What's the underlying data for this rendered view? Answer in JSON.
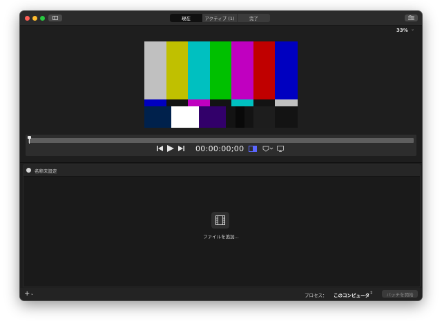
{
  "titlebar": {
    "tabs": [
      {
        "label": "現在",
        "active": true
      },
      {
        "label": "アクティブ (1)",
        "active": false
      },
      {
        "label": "完了",
        "active": false
      }
    ]
  },
  "viewer": {
    "zoom": "33%",
    "timecode": "00:00:00;00",
    "playhead_progress": 0.0,
    "test_pattern": {
      "top_colors": [
        "#c0c0c0",
        "#c0c000",
        "#00c0c0",
        "#00c000",
        "#c000c0",
        "#c00000",
        "#0000c0"
      ],
      "middle_colors": [
        "#0000c0",
        "#131313",
        "#c000c0",
        "#131313",
        "#00c0c0",
        "#131313",
        "#c0c0c0"
      ],
      "bottom_colors": [
        "#00214c",
        "#ffffff",
        "#32006a",
        "#131313",
        "#090909",
        "#131313",
        "#1d1d1d",
        "#131313"
      ]
    }
  },
  "batch": {
    "title": "名称未設定",
    "add_files": "ファイルを追加..."
  },
  "footer": {
    "add_symbol": "+",
    "process_label": "プロセス：",
    "process_value": "このコンピュータ",
    "start_batch": "バッチを開始"
  },
  "colors": {
    "accent": "#5b67ff",
    "window_bg": "#1e1e1e"
  }
}
